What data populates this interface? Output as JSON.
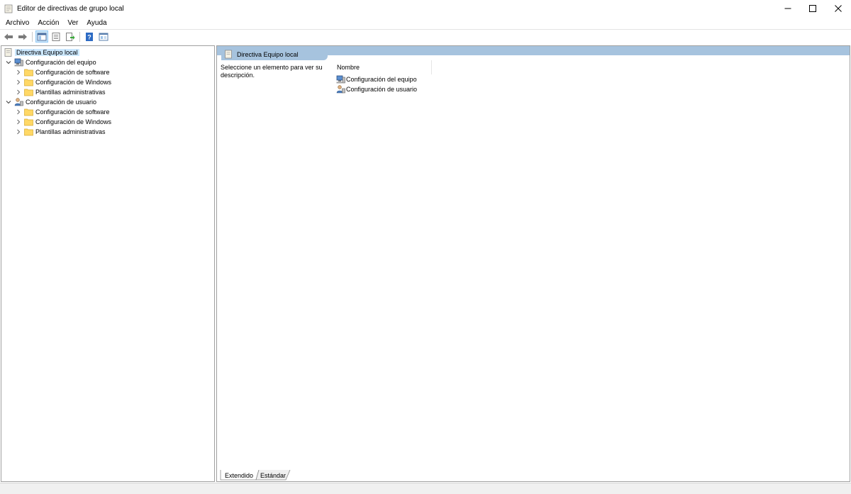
{
  "window": {
    "title": "Editor de directivas de grupo local",
    "minimize_icon": "minimize-icon",
    "maximize_icon": "maximize-icon",
    "close_icon": "close-icon"
  },
  "menu": [
    "Archivo",
    "Acción",
    "Ver",
    "Ayuda"
  ],
  "toolbar": {
    "buttons": [
      "back-arrow-icon",
      "forward-arrow-icon",
      "show-hide-tree-icon",
      "properties-icon",
      "export-list-icon",
      "help-icon",
      "view-icon"
    ]
  },
  "tree": {
    "root": "Directiva Equipo local",
    "computer": "Configuración del equipo",
    "computer_children": [
      "Configuración de software",
      "Configuración de Windows",
      "Plantillas administrativas"
    ],
    "user": "Configuración de usuario",
    "user_children": [
      "Configuración de software",
      "Configuración de Windows",
      "Plantillas administrativas"
    ]
  },
  "right_pane": {
    "header": "Directiva Equipo local",
    "description": "Seleccione un elemento para ver su descripción.",
    "column_header": "Nombre",
    "items": [
      "Configuración del equipo",
      "Configuración de usuario"
    ]
  },
  "tabs": [
    "Extendido",
    "Estándar"
  ],
  "colors": {
    "header_blue": "#a6c3de",
    "selection": "#cce8ff",
    "folder": "#ffd866"
  }
}
